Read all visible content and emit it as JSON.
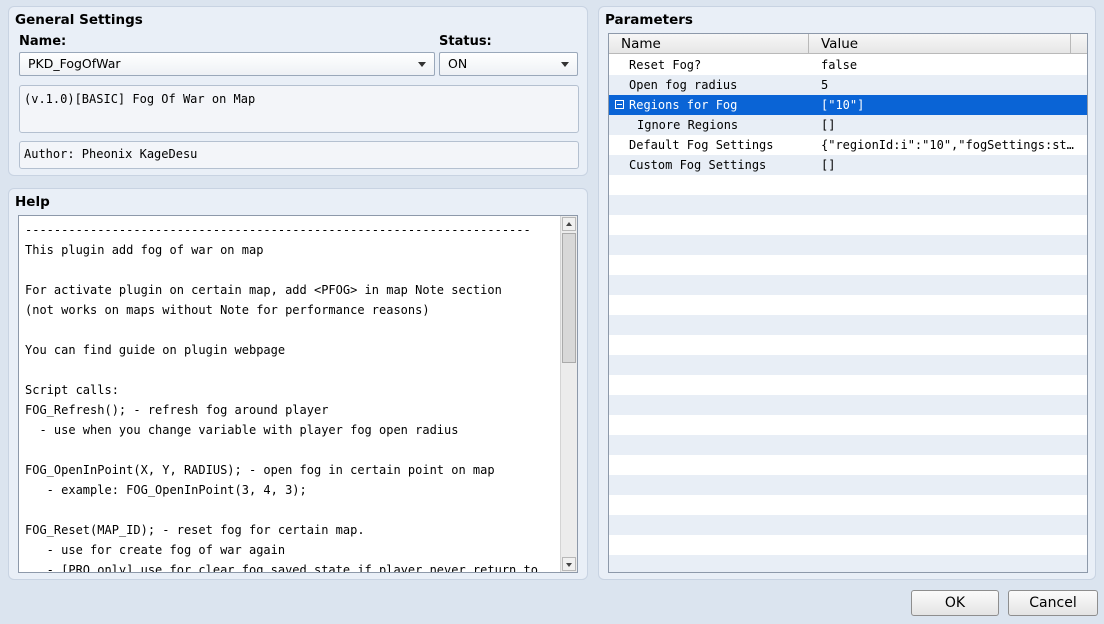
{
  "general": {
    "title": "General Settings",
    "name_label": "Name:",
    "name_value": "PKD_FogOfWar",
    "status_label": "Status:",
    "status_value": "ON",
    "description": "(v.1.0)[BASIC] Fog Of War on Map",
    "author": "Author: Pheonix KageDesu"
  },
  "help": {
    "title": "Help",
    "text": "----------------------------------------------------------------------\nThis plugin add fog of war on map\n\nFor activate plugin on certain map, add <PFOG> in map Note section\n(not works on maps without Note for performance reasons)\n\nYou can find guide on plugin webpage\n\nScript calls:\nFOG_Refresh(); - refresh fog around player\n  - use when you change variable with player fog open radius\n\nFOG_OpenInPoint(X, Y, RADIUS); - open fog in certain point on map\n   - example: FOG_OpenInPoint(3, 4, 3);\n\nFOG_Reset(MAP_ID); - reset fog for certain map.\n   - use for create fog of war again\n   - [PRO only] use for clear fog saved state if player never return to"
  },
  "parameters": {
    "title": "Parameters",
    "col_name": "Name",
    "col_value": "Value",
    "rows": [
      {
        "name": "Reset Fog?",
        "value": "false"
      },
      {
        "name": "Open fog radius",
        "value": "5"
      },
      {
        "name": "Regions for Fog",
        "value": "[\"10\"]"
      },
      {
        "name": "Ignore Regions",
        "value": "[]"
      },
      {
        "name": "Default Fog Settings",
        "value": "{\"regionId:i\":\"10\",\"fogSettings:st…"
      },
      {
        "name": "Custom Fog Settings",
        "value": "[]"
      }
    ]
  },
  "buttons": {
    "ok": "OK",
    "cancel": "Cancel"
  },
  "colors": {
    "selection": "#0a64d6",
    "background": "#dbe4ef"
  }
}
